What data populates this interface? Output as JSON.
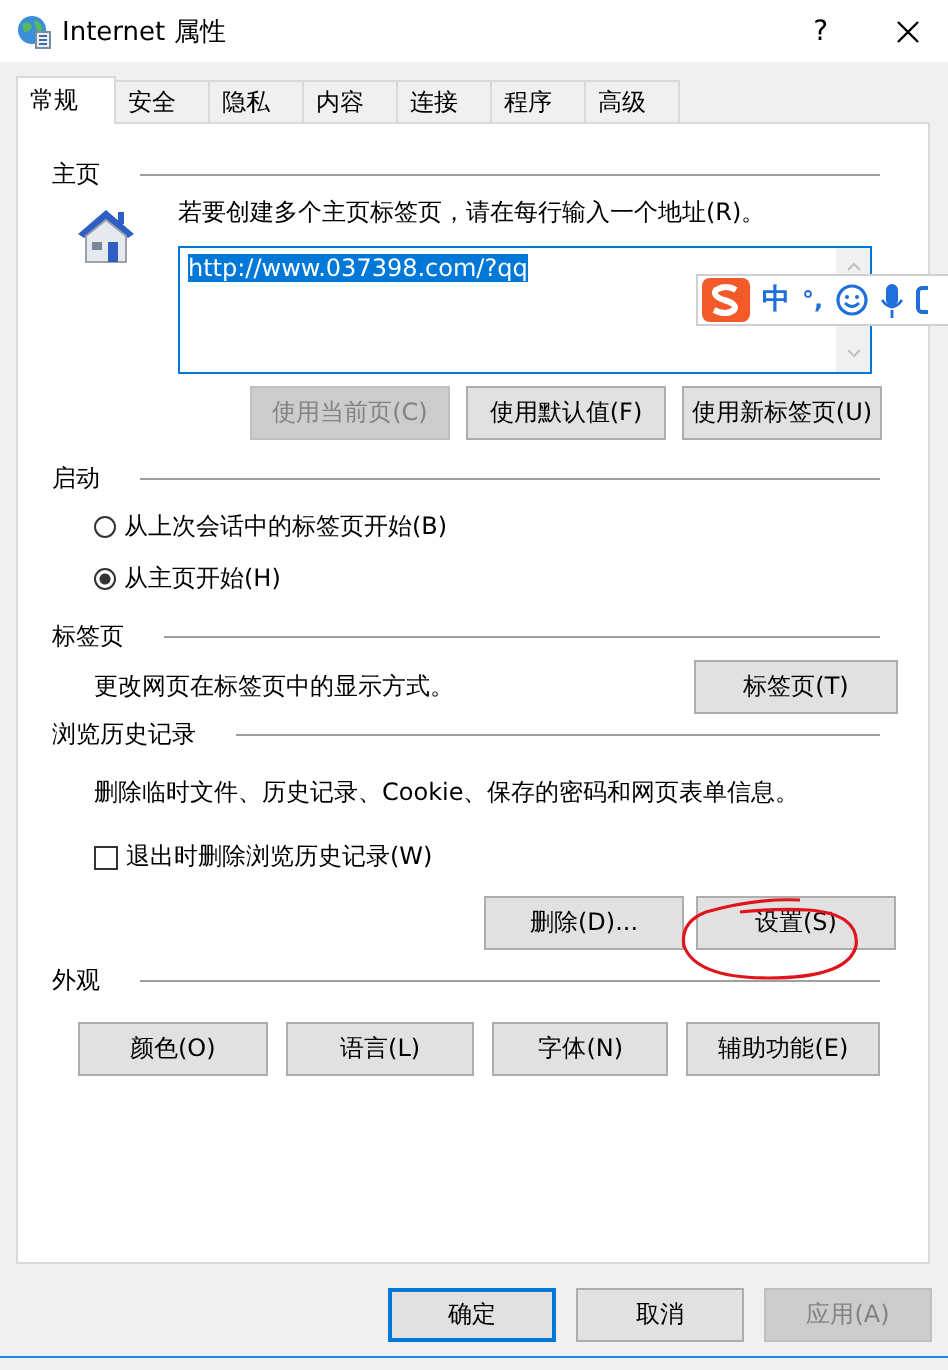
{
  "window": {
    "title": "Internet 属性",
    "help": "?"
  },
  "tabs": [
    {
      "label": "常规",
      "selected": true
    },
    {
      "label": "安全",
      "selected": false
    },
    {
      "label": "隐私",
      "selected": false
    },
    {
      "label": "内容",
      "selected": false
    },
    {
      "label": "连接",
      "selected": false
    },
    {
      "label": "程序",
      "selected": false
    },
    {
      "label": "高级",
      "selected": false
    }
  ],
  "homepage": {
    "heading": "主页",
    "instruction": "若要创建多个主页标签页，请在每行输入一个地址(R)。",
    "url": "http://www.037398.com/?qq",
    "buttons": [
      {
        "label": "使用当前页(C)",
        "disabled": true
      },
      {
        "label": "使用默认值(F)",
        "disabled": false
      },
      {
        "label": "使用新标签页(U)",
        "disabled": false
      }
    ]
  },
  "ime_toolbar": {
    "mode": "中",
    "punctuation": "°,"
  },
  "startup": {
    "heading": "启动",
    "options": [
      {
        "label": "从上次会话中的标签页开始(B)",
        "selected": false
      },
      {
        "label": "从主页开始(H)",
        "selected": true
      }
    ]
  },
  "tabs_section": {
    "heading": "标签页",
    "description": "更改网页在标签页中的显示方式。",
    "button": "标签页(T)"
  },
  "history": {
    "heading": "浏览历史记录",
    "description": "删除临时文件、历史记录、Cookie、保存的密码和网页表单信息。",
    "checkbox": {
      "label": "退出时删除浏览历史记录(W)",
      "checked": false
    },
    "buttons": [
      "删除(D)...",
      "设置(S)"
    ]
  },
  "appearance": {
    "heading": "外观",
    "buttons": [
      "颜色(O)",
      "语言(L)",
      "字体(N)",
      "辅助功能(E)"
    ]
  },
  "footer": {
    "buttons": [
      {
        "label": "确定",
        "default": true,
        "disabled": false
      },
      {
        "label": "取消",
        "default": false,
        "disabled": false
      },
      {
        "label": "应用(A)",
        "default": false,
        "disabled": true
      }
    ]
  }
}
